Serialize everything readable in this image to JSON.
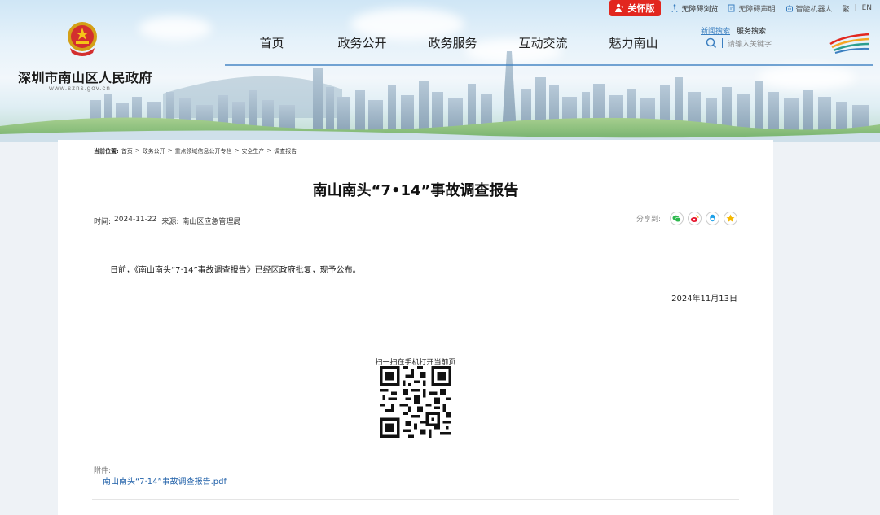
{
  "topbar": {
    "care_label": "关怀版",
    "accessible_browse": "无障碍浏览",
    "accessible_statement": "无障碍声明",
    "robot": "智能机器人",
    "traditional": "繁",
    "english": "EN"
  },
  "site": {
    "name": "深圳市南山区人民政府",
    "url": "www.szns.gov.cn"
  },
  "nav": [
    "首页",
    "政务公开",
    "政务服务",
    "互动交流",
    "魅力南山"
  ],
  "search": {
    "tab_news": "新闻搜索",
    "tab_service": "服务搜索",
    "placeholder": "请输入关键字"
  },
  "breadcrumb": {
    "label": "当前位置:",
    "items": [
      "首页",
      "政务公开",
      "重点领域信息公开专栏",
      "安全生产",
      "调查报告"
    ],
    "sep": ">"
  },
  "article": {
    "title": "南山南头“7•14”事故调查报告",
    "time_label": "时间:",
    "time": "2024-11-22",
    "source_label": "来源:",
    "source": "南山区应急管理局",
    "share_label": "分享到:",
    "paragraph": "日前，《南山南头“7·14”事故调查报告》已经区政府批复，现予公布。",
    "date": "2024年11月13日",
    "qr_label": "扫一扫在手机打开当前页",
    "attach_label": "附件:",
    "attach_file": "南山南头“7·14”事故调查报告.pdf"
  },
  "colors": {
    "accent": "#3b7fc0",
    "care_red": "#e2271f",
    "link": "#1e5fa8"
  }
}
